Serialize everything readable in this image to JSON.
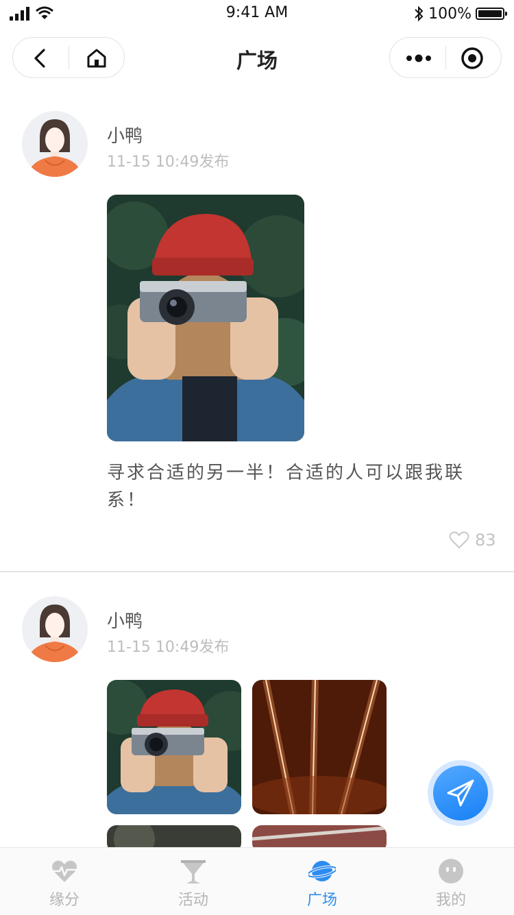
{
  "status_bar": {
    "time": "9:41 AM",
    "battery": "100%"
  },
  "nav": {
    "title": "广场"
  },
  "posts": [
    {
      "username": "小鸭",
      "meta": "11-15  10:49发布",
      "text": "寻求合适的另一半！合适的人可以跟我联系！",
      "likes": "83"
    },
    {
      "username": "小鸭",
      "meta": "11-15  10:49发布"
    }
  ],
  "tabs": [
    {
      "label": "缘分",
      "icon": "heart-pulse-icon"
    },
    {
      "label": "活动",
      "icon": "cocktail-icon"
    },
    {
      "label": "广场",
      "icon": "planet-icon",
      "active": true
    },
    {
      "label": "我的",
      "icon": "face-icon"
    }
  ],
  "colors": {
    "accent": "#2d8cf0",
    "fab": "#1880f5",
    "avatar_shirt": "#f07a45"
  }
}
